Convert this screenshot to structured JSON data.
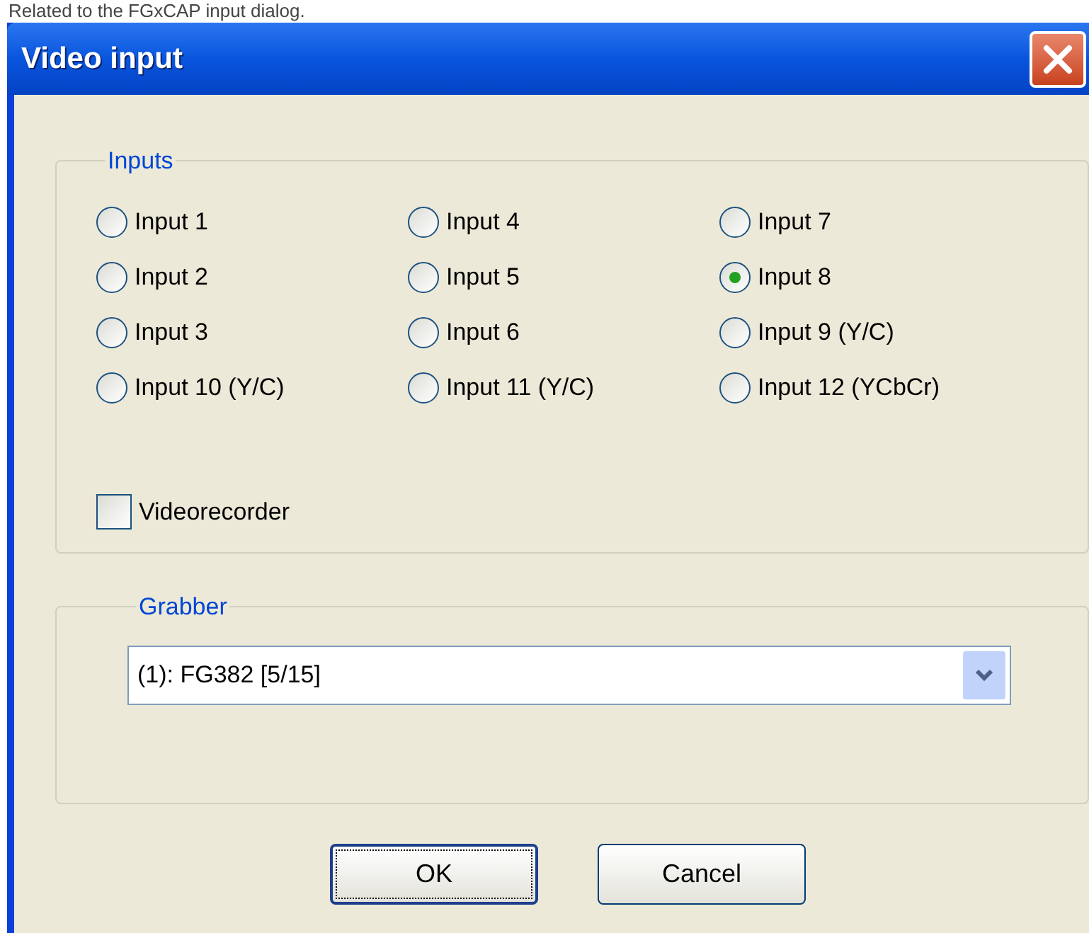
{
  "caption": "Related to the FGxCAP input dialog.",
  "window": {
    "title": "Video input"
  },
  "inputs": {
    "label": "Inputs",
    "options": [
      {
        "label": "Input 1",
        "selected": false
      },
      {
        "label": "Input 4",
        "selected": false
      },
      {
        "label": "Input 7",
        "selected": false
      },
      {
        "label": "Input 2",
        "selected": false
      },
      {
        "label": "Input 5",
        "selected": false
      },
      {
        "label": "Input 8",
        "selected": true
      },
      {
        "label": "Input 3",
        "selected": false
      },
      {
        "label": "Input 6",
        "selected": false
      },
      {
        "label": "Input 9 (Y/C)",
        "selected": false
      },
      {
        "label": "Input 10 (Y/C)",
        "selected": false
      },
      {
        "label": "Input 11 (Y/C)",
        "selected": false
      },
      {
        "label": "Input 12 (YCbCr)",
        "selected": false
      }
    ],
    "videorecorder": {
      "label": "Videorecorder",
      "checked": false
    }
  },
  "grabber": {
    "label": "Grabber",
    "value": "(1): FG382 [5/15]"
  },
  "buttons": [
    {
      "label": "OK",
      "kind": "default"
    },
    {
      "label": "Cancel",
      "kind": "normal"
    }
  ]
}
